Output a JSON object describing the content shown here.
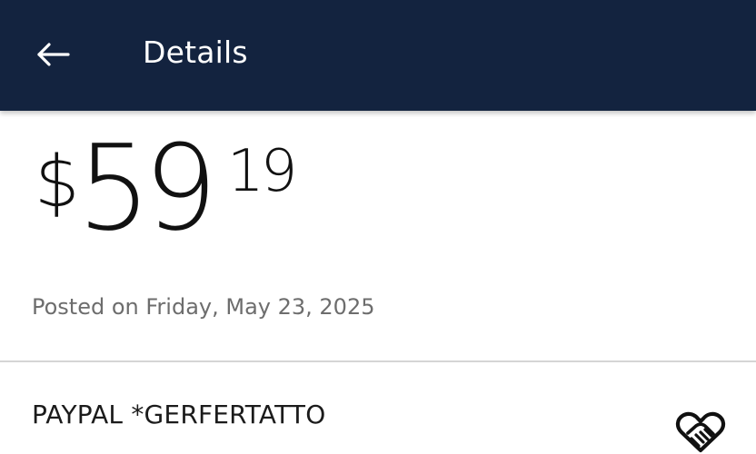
{
  "header": {
    "back_icon": "arrow-left-icon",
    "title": "Details"
  },
  "transaction": {
    "currency_symbol": "$",
    "amount_whole": "59",
    "amount_cents": "19",
    "posted_text": "Posted on Friday, May 23, 2025"
  },
  "merchant": {
    "name": "PAYPAL *GERFERTATTO",
    "icon": "handshake-heart-icon"
  },
  "colors": {
    "header_background": "#13233f",
    "header_text": "#ffffff",
    "amount_text": "#111111",
    "secondary_text": "#6d6d6d",
    "divider": "#d5d5d5"
  }
}
